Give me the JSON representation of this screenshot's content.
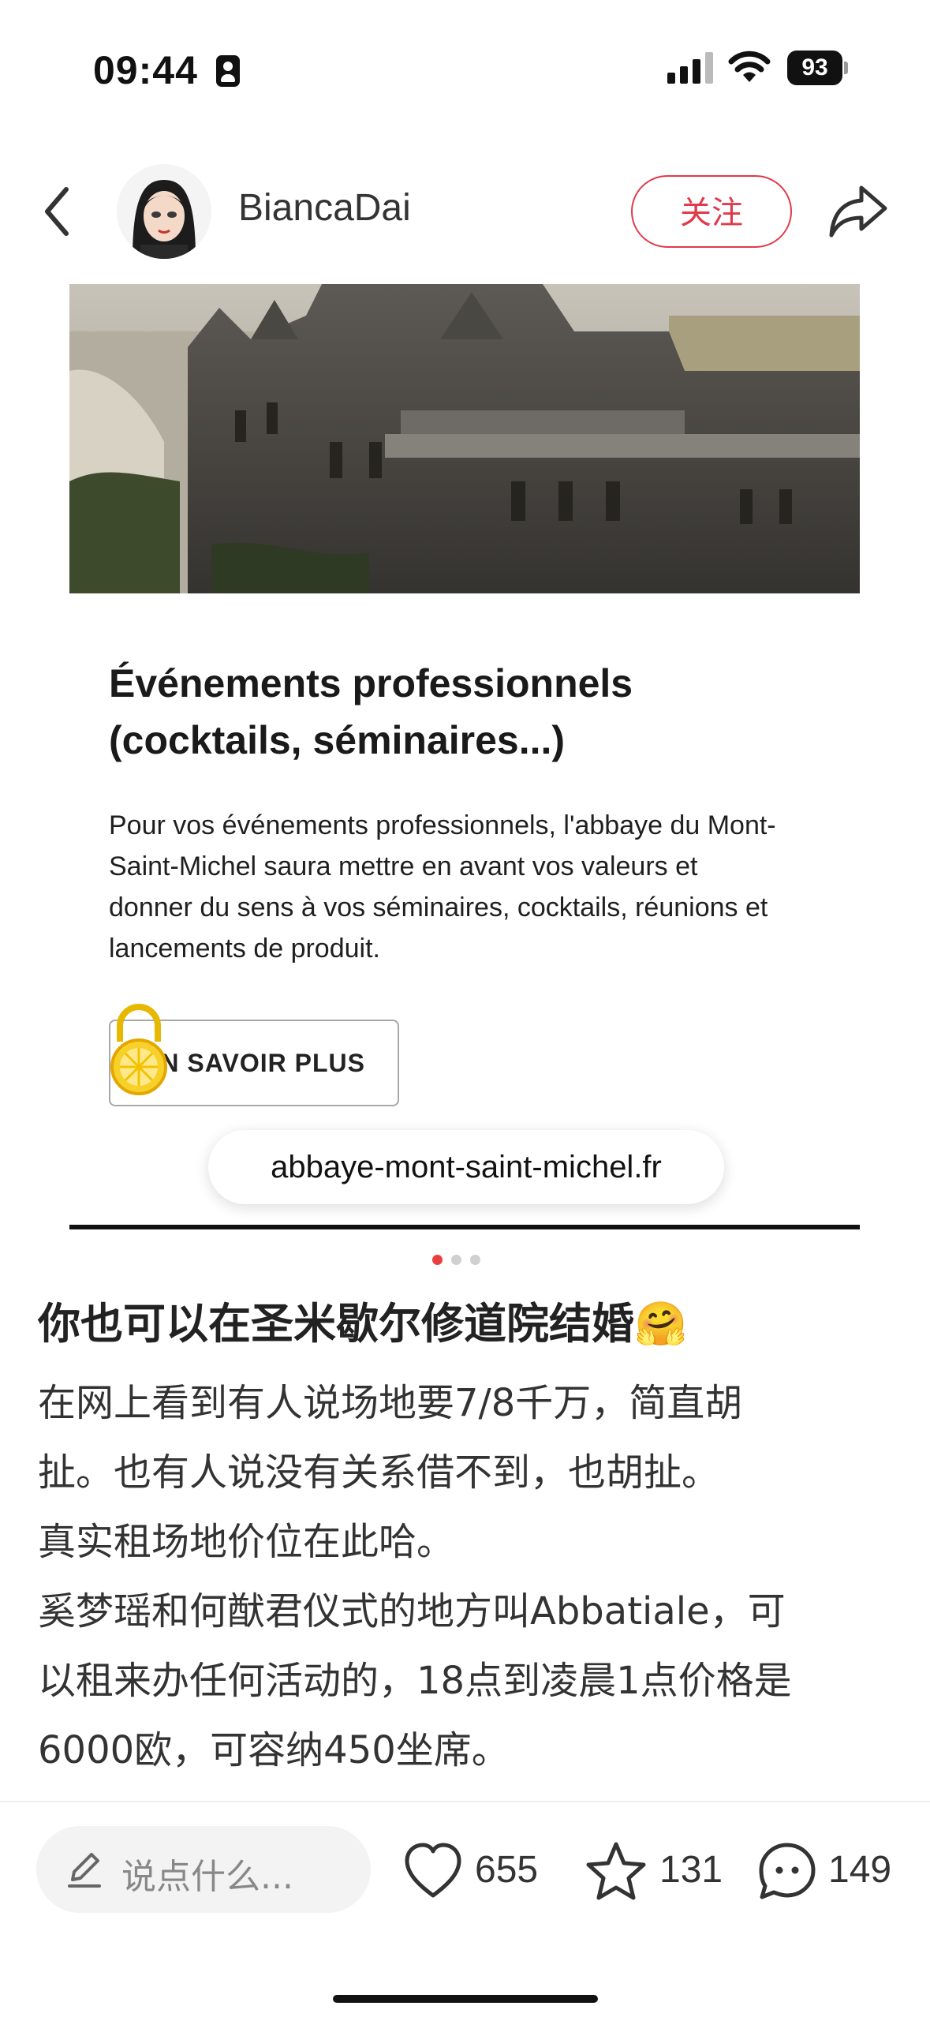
{
  "status_bar": {
    "time": "09:44",
    "battery": "93",
    "icons": [
      "person-id-icon",
      "signal-icon",
      "wifi-icon",
      "battery-icon"
    ]
  },
  "header": {
    "username": "BiancaDai",
    "follow_label": "关注",
    "icons": [
      "back-chevron-icon",
      "avatar",
      "share-icon"
    ]
  },
  "post_image": {
    "card_title_line1": "Événements professionnels",
    "card_title_line2": "(cocktails, séminaires...)",
    "card_text_line1": "Pour vos événements professionnels, l'abbaye du Mont-",
    "card_text_line2": "Saint-Michel saura mettre en avant vos valeurs et",
    "card_text_line3": "donner du sens à vos séminaires, cocktails, réunions et",
    "card_text_line4": "lancements de produit.",
    "button_label": "EN SAVOIR PLUS",
    "url": "abbaye-mont-saint-michel.fr",
    "page_count": 3,
    "current_page": 1
  },
  "post": {
    "title": "你也可以在圣米歇尔修道院结婚🤗",
    "lines": [
      "在网上看到有人说场地要7/8千万，简直胡",
      "扯。也有人说没有关系借不到，也胡扯。",
      "真实租场地价位在此哈。",
      "奚梦瑶和何猷君仪式的地方叫Abbatiale，可",
      "以租来办任何活动的，18点到凌晨1点价格是",
      "6000欧，可容纳450坐席。"
    ]
  },
  "bottom_bar": {
    "comment_placeholder": "说点什么...",
    "likes": "655",
    "favorites": "131",
    "comments": "149"
  },
  "colors": {
    "accent": "#e03a4c",
    "dot_active": "#e8403f"
  }
}
